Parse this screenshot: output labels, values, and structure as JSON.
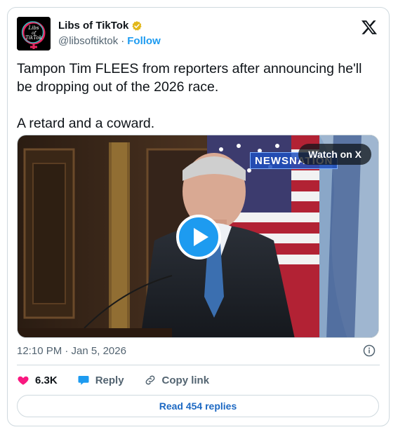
{
  "author": {
    "display_name": "Libs of TikTok",
    "handle": "@libsoftiktok",
    "separator": "·",
    "follow_label": "Follow",
    "avatar_text_line1": "Libs",
    "avatar_text_line2": "of",
    "avatar_text_line3": "TikTok"
  },
  "tweet": {
    "paragraph1": "Tampon Tim FLEES from reporters after announcing he'll be dropping out of the 2026 race.",
    "paragraph2": "A retard and a coward."
  },
  "media": {
    "watch_label": "Watch on X",
    "news_logo_text": "NEWSNATION"
  },
  "meta": {
    "timestamp": "12:10 PM · Jan 5, 2026"
  },
  "actions": {
    "like_count": "6.3K",
    "reply_label": "Reply",
    "copy_label": "Copy link"
  },
  "footer": {
    "read_replies_label": "Read 454 replies"
  },
  "colors": {
    "accent": "#1d9bf0",
    "like": "#f91880",
    "verified_gold": "#e2b719"
  }
}
